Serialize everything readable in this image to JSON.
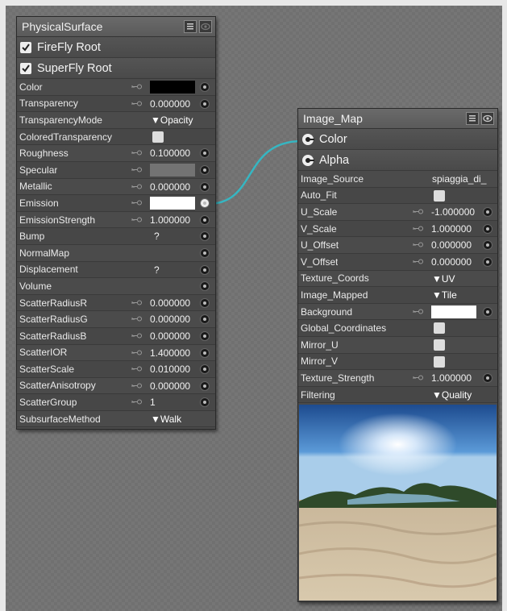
{
  "physical_surface": {
    "title": "PhysicalSurface",
    "fire_fly_root": "FireFly Root",
    "super_fly_root": "SuperFly Root",
    "rows": [
      {
        "label": "Color",
        "kind": "color",
        "swatch": "#000000"
      },
      {
        "label": "Transparency",
        "kind": "num",
        "value": "0.000000"
      },
      {
        "label": "TransparencyMode",
        "kind": "dropdown",
        "value": "▼Opacity"
      },
      {
        "label": "ColoredTransparency",
        "kind": "check"
      },
      {
        "label": "Roughness",
        "kind": "num",
        "value": "0.100000"
      },
      {
        "label": "Specular",
        "kind": "color",
        "swatch": "#737373"
      },
      {
        "label": "Metallic",
        "kind": "num",
        "value": "0.000000"
      },
      {
        "label": "Emission",
        "kind": "color",
        "swatch": "#ffffff",
        "connected": true
      },
      {
        "label": "EmissionStrength",
        "kind": "num",
        "value": "1.000000"
      },
      {
        "label": "Bump",
        "kind": "q",
        "value": "?"
      },
      {
        "label": "NormalMap",
        "kind": "plain"
      },
      {
        "label": "Displacement",
        "kind": "q",
        "value": "?"
      },
      {
        "label": "Volume",
        "kind": "plain"
      },
      {
        "label": "ScatterRadiusR",
        "kind": "num",
        "value": "0.000000"
      },
      {
        "label": "ScatterRadiusG",
        "kind": "num",
        "value": "0.000000"
      },
      {
        "label": "ScatterRadiusB",
        "kind": "num",
        "value": "0.000000"
      },
      {
        "label": "ScatterIOR",
        "kind": "num",
        "value": "1.400000"
      },
      {
        "label": "ScatterScale",
        "kind": "num",
        "value": "0.010000"
      },
      {
        "label": "ScatterAnisotropy",
        "kind": "num",
        "value": "0.000000"
      },
      {
        "label": "ScatterGroup",
        "kind": "num",
        "value": "1"
      },
      {
        "label": "SubsurfaceMethod",
        "kind": "dropdown",
        "value": "▼Walk",
        "noinput": true
      }
    ]
  },
  "image_map": {
    "title": "Image_Map",
    "outputs": [
      "Color",
      "Alpha"
    ],
    "rows": [
      {
        "label": "Image_Source",
        "kind": "text",
        "value": "spiaggia_di_"
      },
      {
        "label": "Auto_Fit",
        "kind": "check"
      },
      {
        "label": "U_Scale",
        "kind": "num",
        "value": "-1.000000"
      },
      {
        "label": "V_Scale",
        "kind": "num",
        "value": "1.000000"
      },
      {
        "label": "U_Offset",
        "kind": "num",
        "value": "0.000000"
      },
      {
        "label": "V_Offset",
        "kind": "num",
        "value": "0.000000"
      },
      {
        "label": "Texture_Coords",
        "kind": "dropdown",
        "value": "▼UV"
      },
      {
        "label": "Image_Mapped",
        "kind": "dropdown",
        "value": "▼Tile"
      },
      {
        "label": "Background",
        "kind": "color",
        "swatch": "#ffffff"
      },
      {
        "label": "Global_Coordinates",
        "kind": "check"
      },
      {
        "label": "Mirror_U",
        "kind": "check"
      },
      {
        "label": "Mirror_V",
        "kind": "check"
      },
      {
        "label": "Texture_Strength",
        "kind": "num",
        "value": "1.000000"
      },
      {
        "label": "Filtering",
        "kind": "dropdown",
        "value": "▼Quality"
      }
    ]
  },
  "colors": {
    "link_wire": "#36b6c2",
    "node_bg": "#4a4a4a"
  }
}
